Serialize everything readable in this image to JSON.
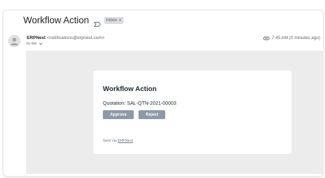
{
  "header": {
    "subject": "Workflow Action",
    "label": "Inbox",
    "label_close": "x"
  },
  "sender": {
    "name": "ERPNext",
    "email": "<notifications@erpnext.com>",
    "to": "to me",
    "time": "7:45 AM (0 minutes ago)"
  },
  "body": {
    "title": "Workflow Action",
    "quotation": "Quotation: SAL-QTN-2021-00003",
    "approve_label": "Approve",
    "reject_label": "Reject",
    "sent_via_prefix": "Sent via",
    "sent_via_link": "ERPNext"
  },
  "colors": {
    "button_bg": "#8d99a6",
    "body_bg": "#ececec"
  },
  "icons": {
    "important": "important-marker-icon",
    "attachment": "attachment-icon",
    "avatar": "avatar-person-icon",
    "recipient_dropdown": "chevron-down-icon"
  }
}
